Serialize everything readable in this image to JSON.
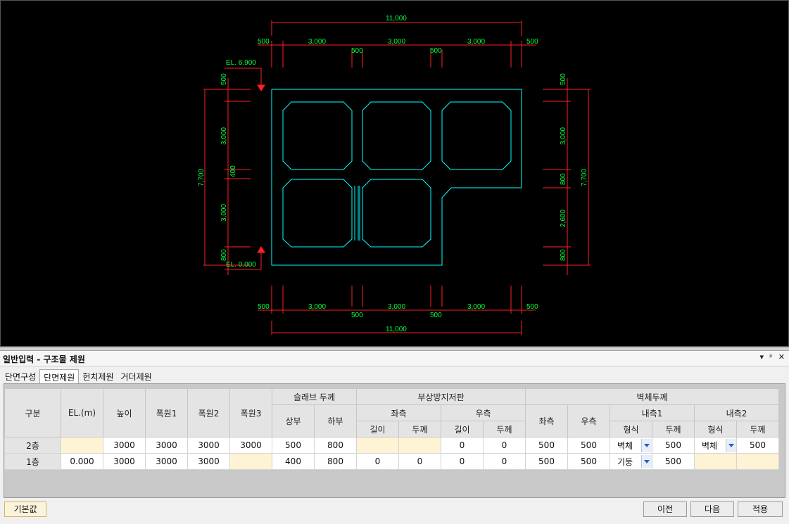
{
  "drawing": {
    "dims_top": {
      "total": "11,000",
      "seg_a": "500",
      "seg_b": "3,000",
      "seg_c": "3,000",
      "seg_d": "3,000",
      "seg_e": "500",
      "wall_1": "500",
      "wall_2": "500"
    },
    "dims_bottom": {
      "total": "11,000",
      "seg_a": "500",
      "seg_b": "3,000",
      "seg_c": "3,000",
      "seg_d": "3,000",
      "seg_e": "500",
      "wall_1": "500",
      "wall_2": "500"
    },
    "dims_left": {
      "total": "7,700",
      "top_slab": "500",
      "upper": "3,000",
      "mid_slab": "400",
      "lower": "3,000",
      "bottom_slab": "800"
    },
    "dims_right": {
      "total": "7,700",
      "top_slab": "500",
      "upper": "3,000",
      "mid": "800",
      "lower": "2,600",
      "bottom_slab": "800"
    },
    "el_top": "EL. 6.900",
    "el_bottom": "EL. 0.000",
    "line_color": "#00ffff",
    "dim_color": "#ff2020",
    "text_color": "#00ff40"
  },
  "panel": {
    "title": "일반입력 - 구조물 제원",
    "pin_label": "▾ ᵖ ✕",
    "tabs": [
      "단면구성",
      "단면제원",
      "헌치제원",
      "거더제원"
    ],
    "active_tab": "단면제원"
  },
  "table": {
    "headers": {
      "gubun": "구분",
      "el": "EL.(m)",
      "height": "높이",
      "width1": "폭원1",
      "width2": "폭원2",
      "width3": "폭원3",
      "slab": "슬래브 두께",
      "slab_top": "상부",
      "slab_bot": "하부",
      "float": "부상방지저판",
      "float_left": "좌측",
      "float_right": "우측",
      "len": "길이",
      "thk": "두께",
      "wall": "벽체두께",
      "wall_left": "좌측",
      "wall_right": "우측",
      "inner1": "내측1",
      "inner2": "내측2",
      "type": "형식"
    },
    "rows": [
      {
        "label": "2층",
        "el": "",
        "height": "3000",
        "w1": "3000",
        "w2": "3000",
        "w3": "3000",
        "slab_top": "500",
        "slab_bot": "800",
        "fl_len": "",
        "fl_thk": "",
        "fr_len": "0",
        "fr_thk": "0",
        "wl": "500",
        "wr": "500",
        "in1_type": "벽체",
        "in1_thk": "500",
        "in2_type": "벽체",
        "in2_thk": "500"
      },
      {
        "label": "1층",
        "el": "0.000",
        "height": "3000",
        "w1": "3000",
        "w2": "3000",
        "w3": "",
        "slab_top": "400",
        "slab_bot": "800",
        "fl_len": "0",
        "fl_thk": "0",
        "fr_len": "0",
        "fr_thk": "0",
        "wl": "500",
        "wr": "500",
        "in1_type": "기둥",
        "in1_thk": "500",
        "in2_type": "",
        "in2_thk": ""
      }
    ]
  },
  "buttons": {
    "default": "기본값",
    "prev": "이전",
    "next": "다음",
    "apply": "적용"
  }
}
